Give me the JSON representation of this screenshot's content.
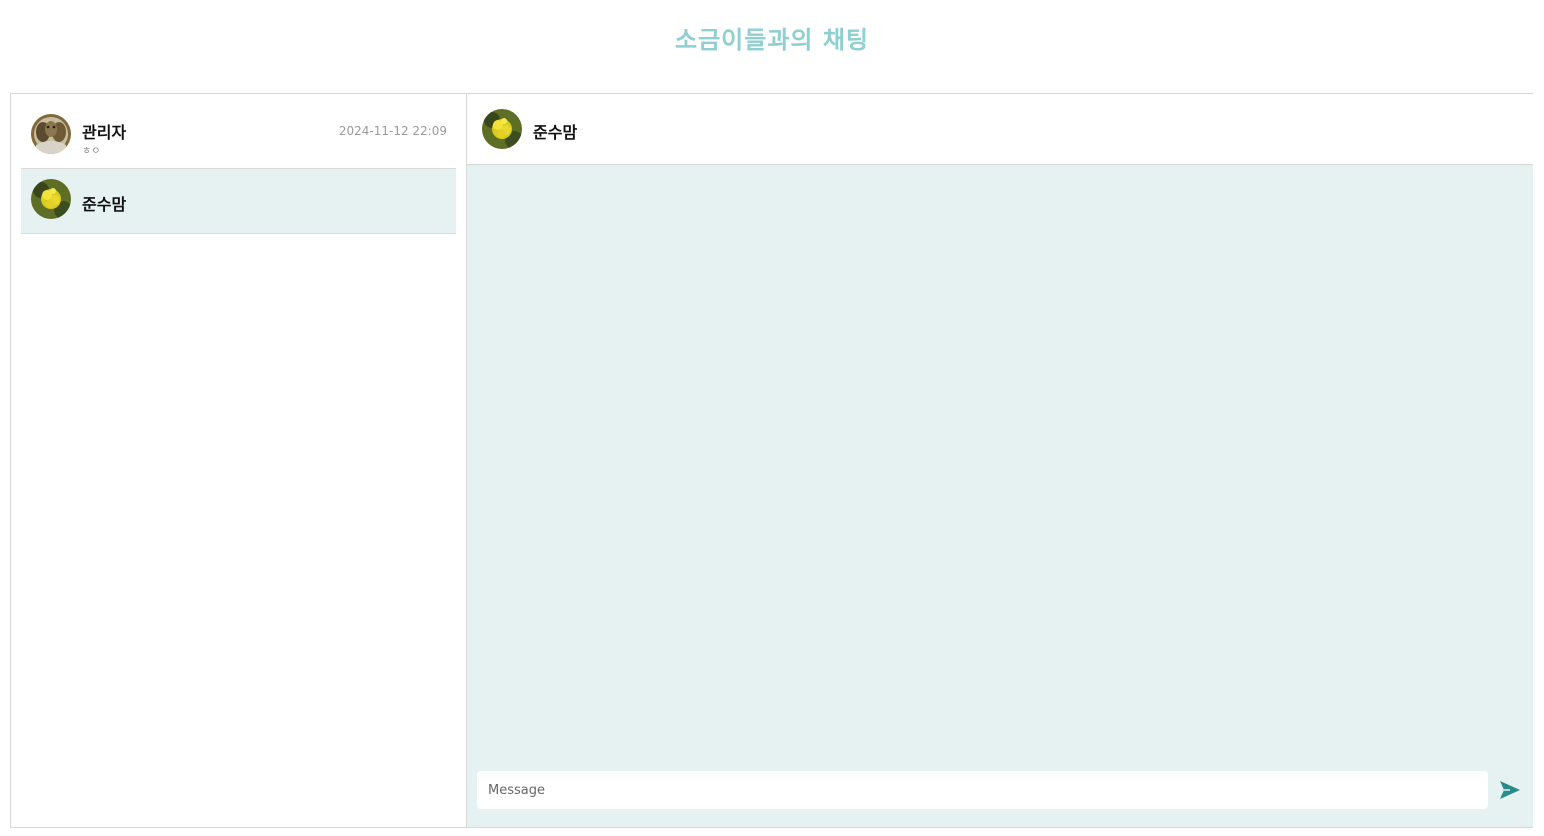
{
  "page": {
    "title": "소금이들과의 채팅"
  },
  "sidebar": {
    "rooms": [
      {
        "name": "관리자",
        "preview": "ㅎㅇ",
        "time": "2024-11-12 22:09",
        "avatar": "owl-photo-avatar"
      },
      {
        "name": "준수맘",
        "preview": "",
        "time": "",
        "avatar": "yellow-flower-avatar"
      }
    ]
  },
  "chat": {
    "header_name": "준수맘",
    "header_avatar": "yellow-flower-avatar",
    "input_placeholder": "Message",
    "input_value": "",
    "send_icon": "send-icon"
  },
  "colors": {
    "title": "#8ecfd0",
    "message_background": "#e6f2f2",
    "selected_room": "#e6f2f2",
    "send_icon": "#2a8a87"
  }
}
